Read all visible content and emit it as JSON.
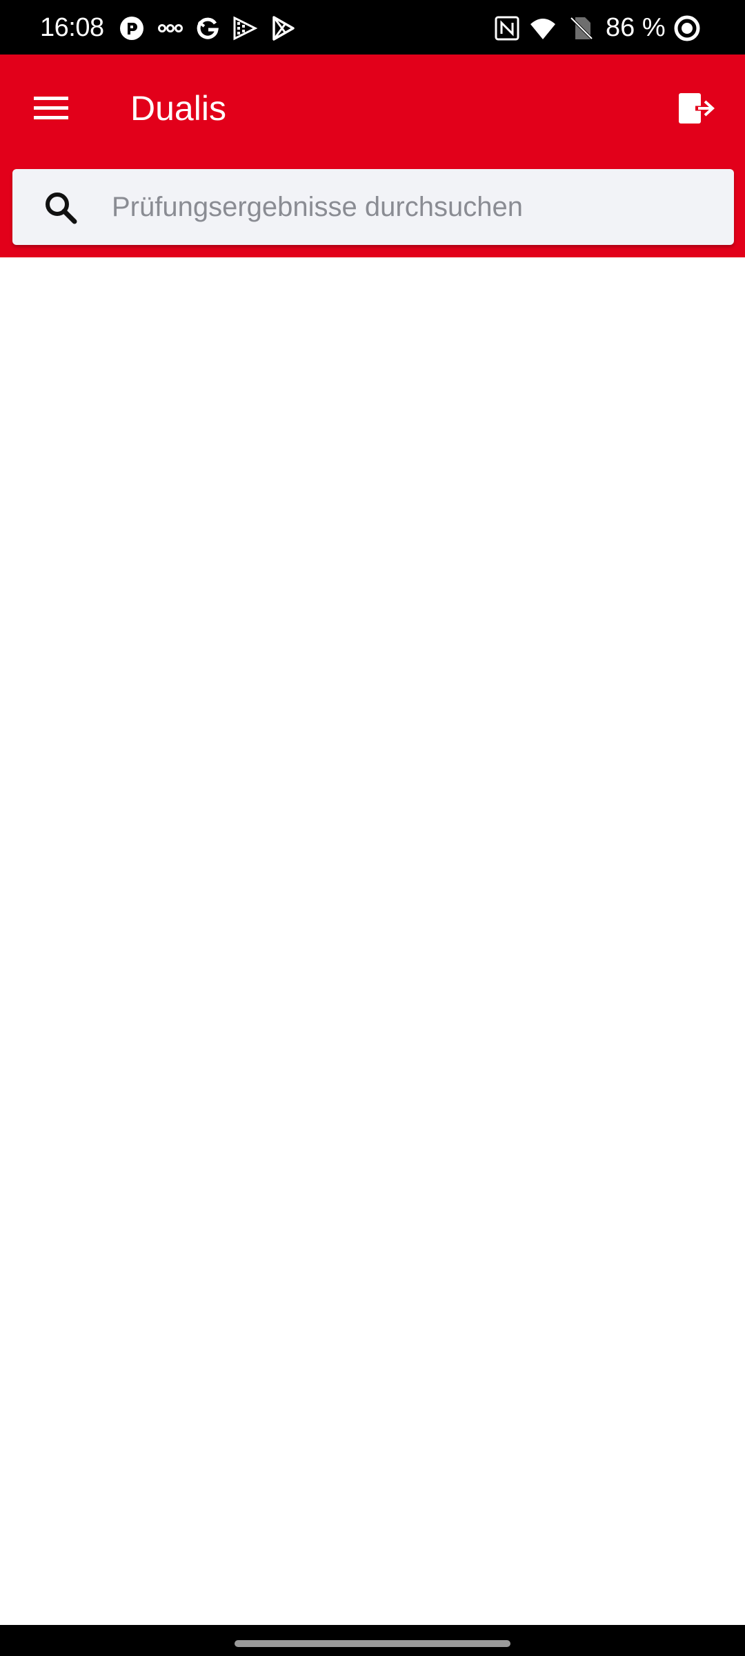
{
  "status_bar": {
    "time": "16:08",
    "battery": "86 %",
    "notification_icons": [
      "pocket-casts-icon",
      "infinity-icon",
      "g-app-icon",
      "play-games-icon",
      "play-store-icon"
    ],
    "system_icons": [
      "nfc-icon",
      "wifi-icon",
      "no-sim-icon",
      "battery-ring-icon"
    ]
  },
  "app_bar": {
    "title": "Dualis",
    "menu_icon": "hamburger-menu-icon",
    "logout_icon": "logout-icon",
    "background_color": "#e2001a"
  },
  "search": {
    "placeholder": "Prüfungsergebnisse durchsuchen",
    "value": "",
    "icon": "search-icon"
  }
}
